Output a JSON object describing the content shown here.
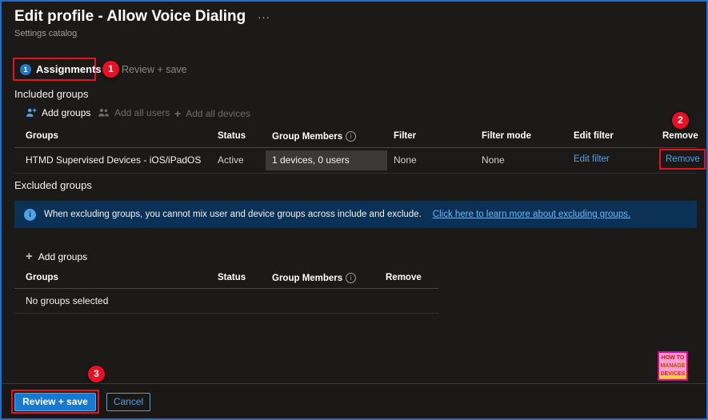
{
  "header": {
    "title": "Edit profile - Allow Voice Dialing",
    "menu_ellipsis": "···",
    "subtitle": "Settings catalog"
  },
  "tabs": {
    "assignments": "Assignments",
    "review_save": "Review + save"
  },
  "icons": {
    "step_glyph": "1",
    "info_glyph": "i",
    "plus_glyph": "+"
  },
  "annotations": {
    "n1": "1",
    "n2": "2",
    "n3": "3"
  },
  "included": {
    "title": "Included groups",
    "toolbar": {
      "add_groups": "Add groups",
      "add_all_users": "Add all users",
      "add_all_devices": "Add all devices"
    },
    "columns": {
      "groups": "Groups",
      "status": "Status",
      "group_members": "Group Members",
      "filter": "Filter",
      "filter_mode": "Filter mode",
      "edit_filter": "Edit filter",
      "remove": "Remove"
    },
    "row": {
      "group": "HTMD Supervised Devices - iOS/iPadOS",
      "status": "Active",
      "members": "1 devices, 0 users",
      "filter": "None",
      "filter_mode": "None",
      "edit_filter_link": "Edit filter",
      "remove_link": "Remove"
    }
  },
  "excluded": {
    "title": "Excluded groups",
    "banner_text": "When excluding groups, you cannot mix user and device groups across include and exclude.",
    "banner_link": "Click here to learn more about excluding groups.",
    "add_groups": "Add groups",
    "columns": {
      "groups": "Groups",
      "status": "Status",
      "group_members": "Group Members",
      "remove": "Remove"
    },
    "empty": "No groups selected"
  },
  "footer": {
    "review_save": "Review + save",
    "cancel": "Cancel"
  },
  "badge": {
    "line1": "HOW TO",
    "line2": "MANAGE",
    "line3": "DEVICES"
  },
  "colors": {
    "accent_blue": "#4fa3e3",
    "annotation_red": "#e81123",
    "primary_button": "#1779d2",
    "banner_bg": "#0c3156"
  }
}
